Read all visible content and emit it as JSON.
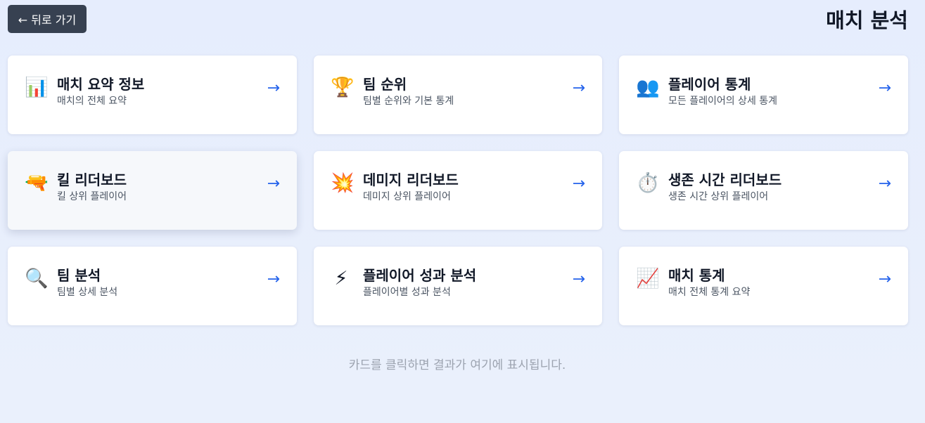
{
  "header": {
    "back_label": "← 뒤로 가기",
    "title": "매치 분석"
  },
  "cards": [
    {
      "icon": "bar-chart-icon",
      "glyph": "📊",
      "title": "매치 요약 정보",
      "desc": "매치의 전체 요약",
      "arrow": "→"
    },
    {
      "icon": "trophy-icon",
      "glyph": "🏆",
      "title": "팀 순위",
      "desc": "팀별 순위와 기본 통계",
      "arrow": "→"
    },
    {
      "icon": "people-icon",
      "glyph": "👥",
      "title": "플레이어 통계",
      "desc": "모든 플레이어의 상세 통계",
      "arrow": "→"
    },
    {
      "icon": "pistol-icon",
      "glyph": "🔫",
      "title": "킬 리더보드",
      "desc": "킬 상위 플레이어",
      "arrow": "→"
    },
    {
      "icon": "explosion-icon",
      "glyph": "💥",
      "title": "데미지 리더보드",
      "desc": "데미지 상위 플레이어",
      "arrow": "→"
    },
    {
      "icon": "stopwatch-icon",
      "glyph": "⏱️",
      "title": "생존 시간 리더보드",
      "desc": "생존 시간 상위 플레이어",
      "arrow": "→"
    },
    {
      "icon": "magnifier-icon",
      "glyph": "🔍",
      "title": "팀 분석",
      "desc": "팀별 상세 분석",
      "arrow": "→"
    },
    {
      "icon": "lightning-icon",
      "glyph": "⚡",
      "title": "플레이어 성과 분석",
      "desc": "플레이어별 성과 분석",
      "arrow": "→"
    },
    {
      "icon": "line-chart-icon",
      "glyph": "📈",
      "title": "매치 통계",
      "desc": "매치 전체 통계 요약",
      "arrow": "→"
    }
  ],
  "hint": "카드를 클릭하면 결과가 여기에 표시됩니다.",
  "colors": {
    "accent": "#2563eb",
    "back_button": "#374151",
    "background": "#e8eefc"
  }
}
